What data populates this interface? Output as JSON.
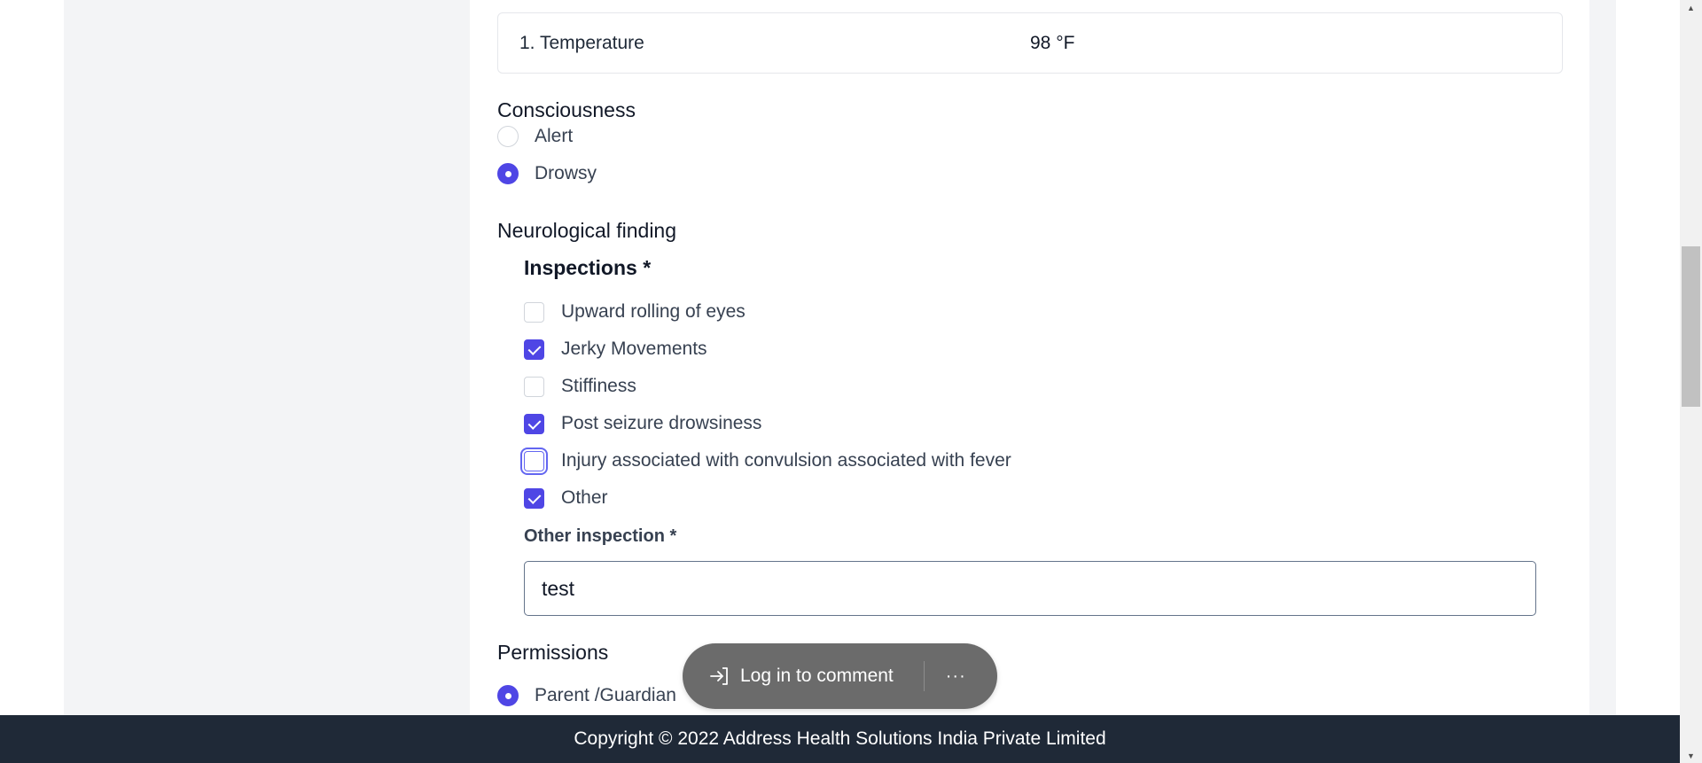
{
  "vitals": {
    "temperature_label": "1. Temperature",
    "temperature_value": "98 °F"
  },
  "consciousness": {
    "title": "Consciousness",
    "options": [
      {
        "label": "Alert",
        "checked": false
      },
      {
        "label": "Drowsy",
        "checked": true
      }
    ]
  },
  "neurological": {
    "title": "Neurological finding",
    "inspections_title": "Inspections *",
    "items": [
      {
        "label": "Upward rolling of eyes",
        "checked": false
      },
      {
        "label": "Jerky Movements",
        "checked": true
      },
      {
        "label": "Stiffiness",
        "checked": false
      },
      {
        "label": "Post seizure drowsiness",
        "checked": true
      },
      {
        "label": "Injury associated with convulsion associated with fever",
        "checked": false,
        "focused": true
      },
      {
        "label": "Other",
        "checked": true
      }
    ],
    "other_label": "Other inspection *",
    "other_value": "test"
  },
  "permissions": {
    "title": "Permissions",
    "first_option_partial": "Parent /Guardian"
  },
  "toast": {
    "label": "Log in to comment",
    "more": "···",
    "icon": "login-arrow-icon"
  },
  "footer": {
    "text": "Copyright © 2022 Address Health Solutions India Private Limited"
  },
  "colors": {
    "accent": "#4f46e5",
    "footer_bg": "#1f2937",
    "toast_bg": "#6b6b6b"
  }
}
